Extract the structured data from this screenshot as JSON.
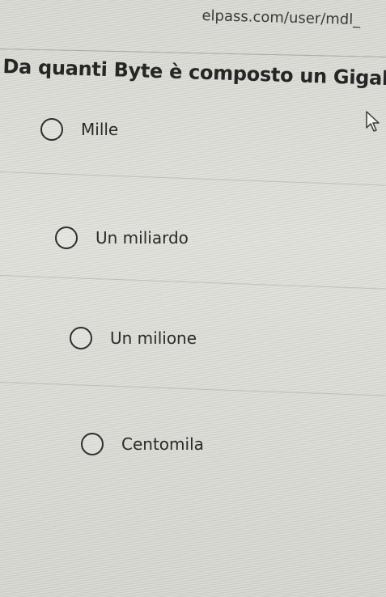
{
  "browser": {
    "url_fragment": "elpass.com/user/mdl_"
  },
  "quiz": {
    "question": "Da quanti Byte è composto un Gigabyte?",
    "options": [
      {
        "label": "Mille",
        "selected": false
      },
      {
        "label": "Un miliardo",
        "selected": false
      },
      {
        "label": "Un milione",
        "selected": false
      },
      {
        "label": "Centomila",
        "selected": false
      }
    ]
  },
  "icons": {
    "radio": "radio-unchecked-icon",
    "cursor": "mouse-pointer-icon"
  }
}
